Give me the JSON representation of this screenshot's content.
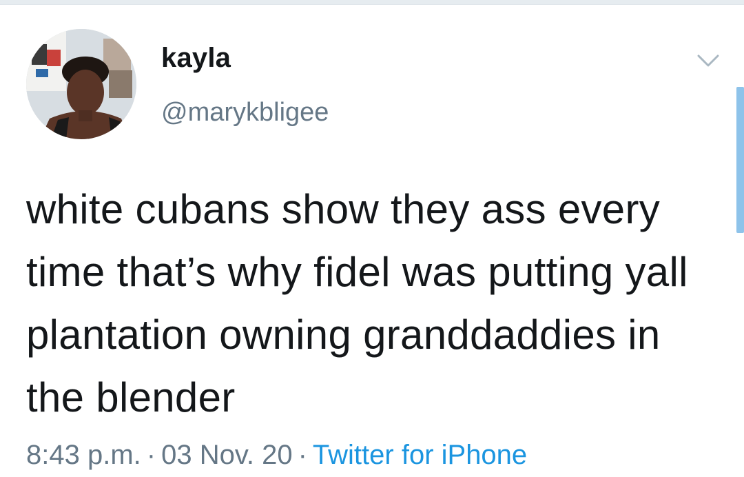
{
  "author": {
    "display_name": "kayla",
    "handle": "@marykbligee",
    "avatar_icon": "user-avatar-photo"
  },
  "tweet": {
    "text": "white cubans show they ass every time that’s why fidel was putting yall plantation owning granddaddies in the blender",
    "time": "8:43 p.m.",
    "date": "03 Nov. 20",
    "separator": "·",
    "source": "Twitter for iPhone"
  },
  "icons": {
    "menu": "chevron-down-icon"
  },
  "colors": {
    "text_primary": "#14171a",
    "text_secondary": "#657786",
    "link": "#1b95e0",
    "scrollbar": "#8ec3ea"
  }
}
